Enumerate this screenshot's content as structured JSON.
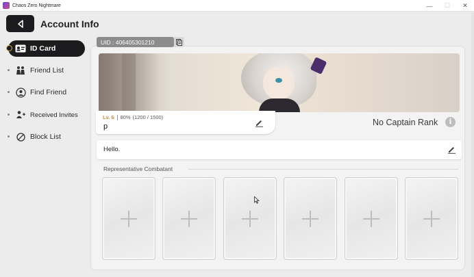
{
  "window": {
    "title": "Chaos Zero Nightmare",
    "controls": {
      "minimize": "—",
      "maximize": "☐",
      "close": "✕"
    }
  },
  "header": {
    "title": "Account Info",
    "back_icon": "back-arrow-icon"
  },
  "sidebar": {
    "items": [
      {
        "label": "ID Card",
        "icon": "id-card-icon",
        "active": true
      },
      {
        "label": "Friend List",
        "icon": "friends-icon",
        "active": false
      },
      {
        "label": "Find Friend",
        "icon": "find-friend-icon",
        "active": false
      },
      {
        "label": "Received Invites",
        "icon": "invites-icon",
        "active": false
      },
      {
        "label": "Block List",
        "icon": "block-icon",
        "active": false
      }
    ]
  },
  "profile": {
    "uid": "UID : 406405301210",
    "level": "Lv. 6",
    "exp_percent": "80%",
    "exp_detail": "(1200 / 1500)",
    "name": "p",
    "captain_rank": "No Captain Rank",
    "info_symbol": "i",
    "greeting": "Hello."
  },
  "combatants": {
    "title": "Representative Combatant",
    "slots": [
      "empty",
      "empty",
      "empty",
      "empty",
      "empty",
      "empty"
    ]
  },
  "colors": {
    "accent_dark": "#1c1c1e",
    "level_color": "#d08a1e",
    "active_ring": "#d9b24a"
  }
}
